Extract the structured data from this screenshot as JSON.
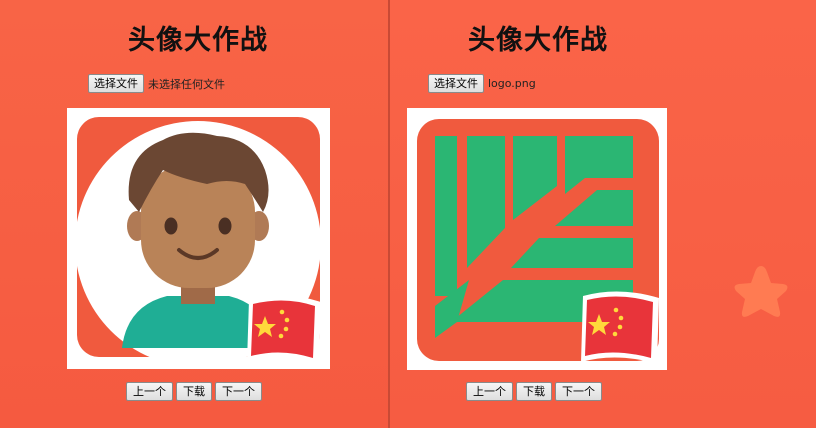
{
  "left_panel": {
    "title": "头像大作战",
    "choose_file_label": "选择文件",
    "file_status": "未选择任何文件",
    "prev_label": "上一个",
    "download_label": "下载",
    "next_label": "下一个"
  },
  "right_panel": {
    "title": "头像大作战",
    "choose_file_label": "选择文件",
    "file_status": "logo.png",
    "prev_label": "上一个",
    "download_label": "下载",
    "next_label": "下一个"
  },
  "colors": {
    "background": "#f85c42",
    "frame_red": "#f05a3e",
    "logo_green": "#2bb673",
    "flag_red": "#e8343a",
    "flag_star": "#ffd93b",
    "deco_star": "#ff7b52"
  },
  "icons": {
    "avatar": "boy-avatar",
    "flag": "china-flag-icon",
    "deco": "star-icon"
  }
}
